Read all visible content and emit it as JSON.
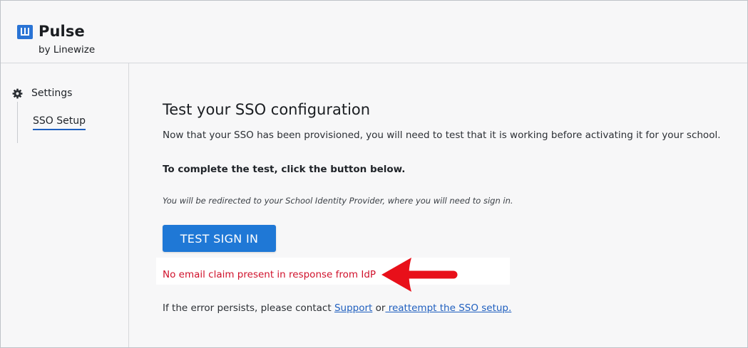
{
  "brand": {
    "name": "Pulse",
    "subtitle": "by Linewize",
    "icon": "linewize-logo-icon",
    "color": "#2a74d5"
  },
  "sidebar": {
    "section_label": "Settings",
    "section_icon": "gear-icon",
    "items": [
      {
        "label": "SSO Setup",
        "active": true
      }
    ]
  },
  "main": {
    "title": "Test your SSO configuration",
    "description": "Now that your SSO has been provisioned, you will need to test that it is working before activating it for your school.",
    "instruction": "To complete the test, click the button below.",
    "note": "You will be redirected to your School Identity Provider, where you will need to sign in.",
    "button_label": "TEST SIGN IN",
    "error_message": "No email claim present in response from IdP",
    "help": {
      "prefix": "If the error persists, please contact ",
      "support_link": "Support",
      "middle": " or",
      "reattempt_link": " reattempt the SSO setup."
    }
  },
  "colors": {
    "accent": "#1f78d6",
    "error": "#d0112b",
    "link": "#1f5fbf",
    "annotation_arrow": "#e8101a"
  }
}
